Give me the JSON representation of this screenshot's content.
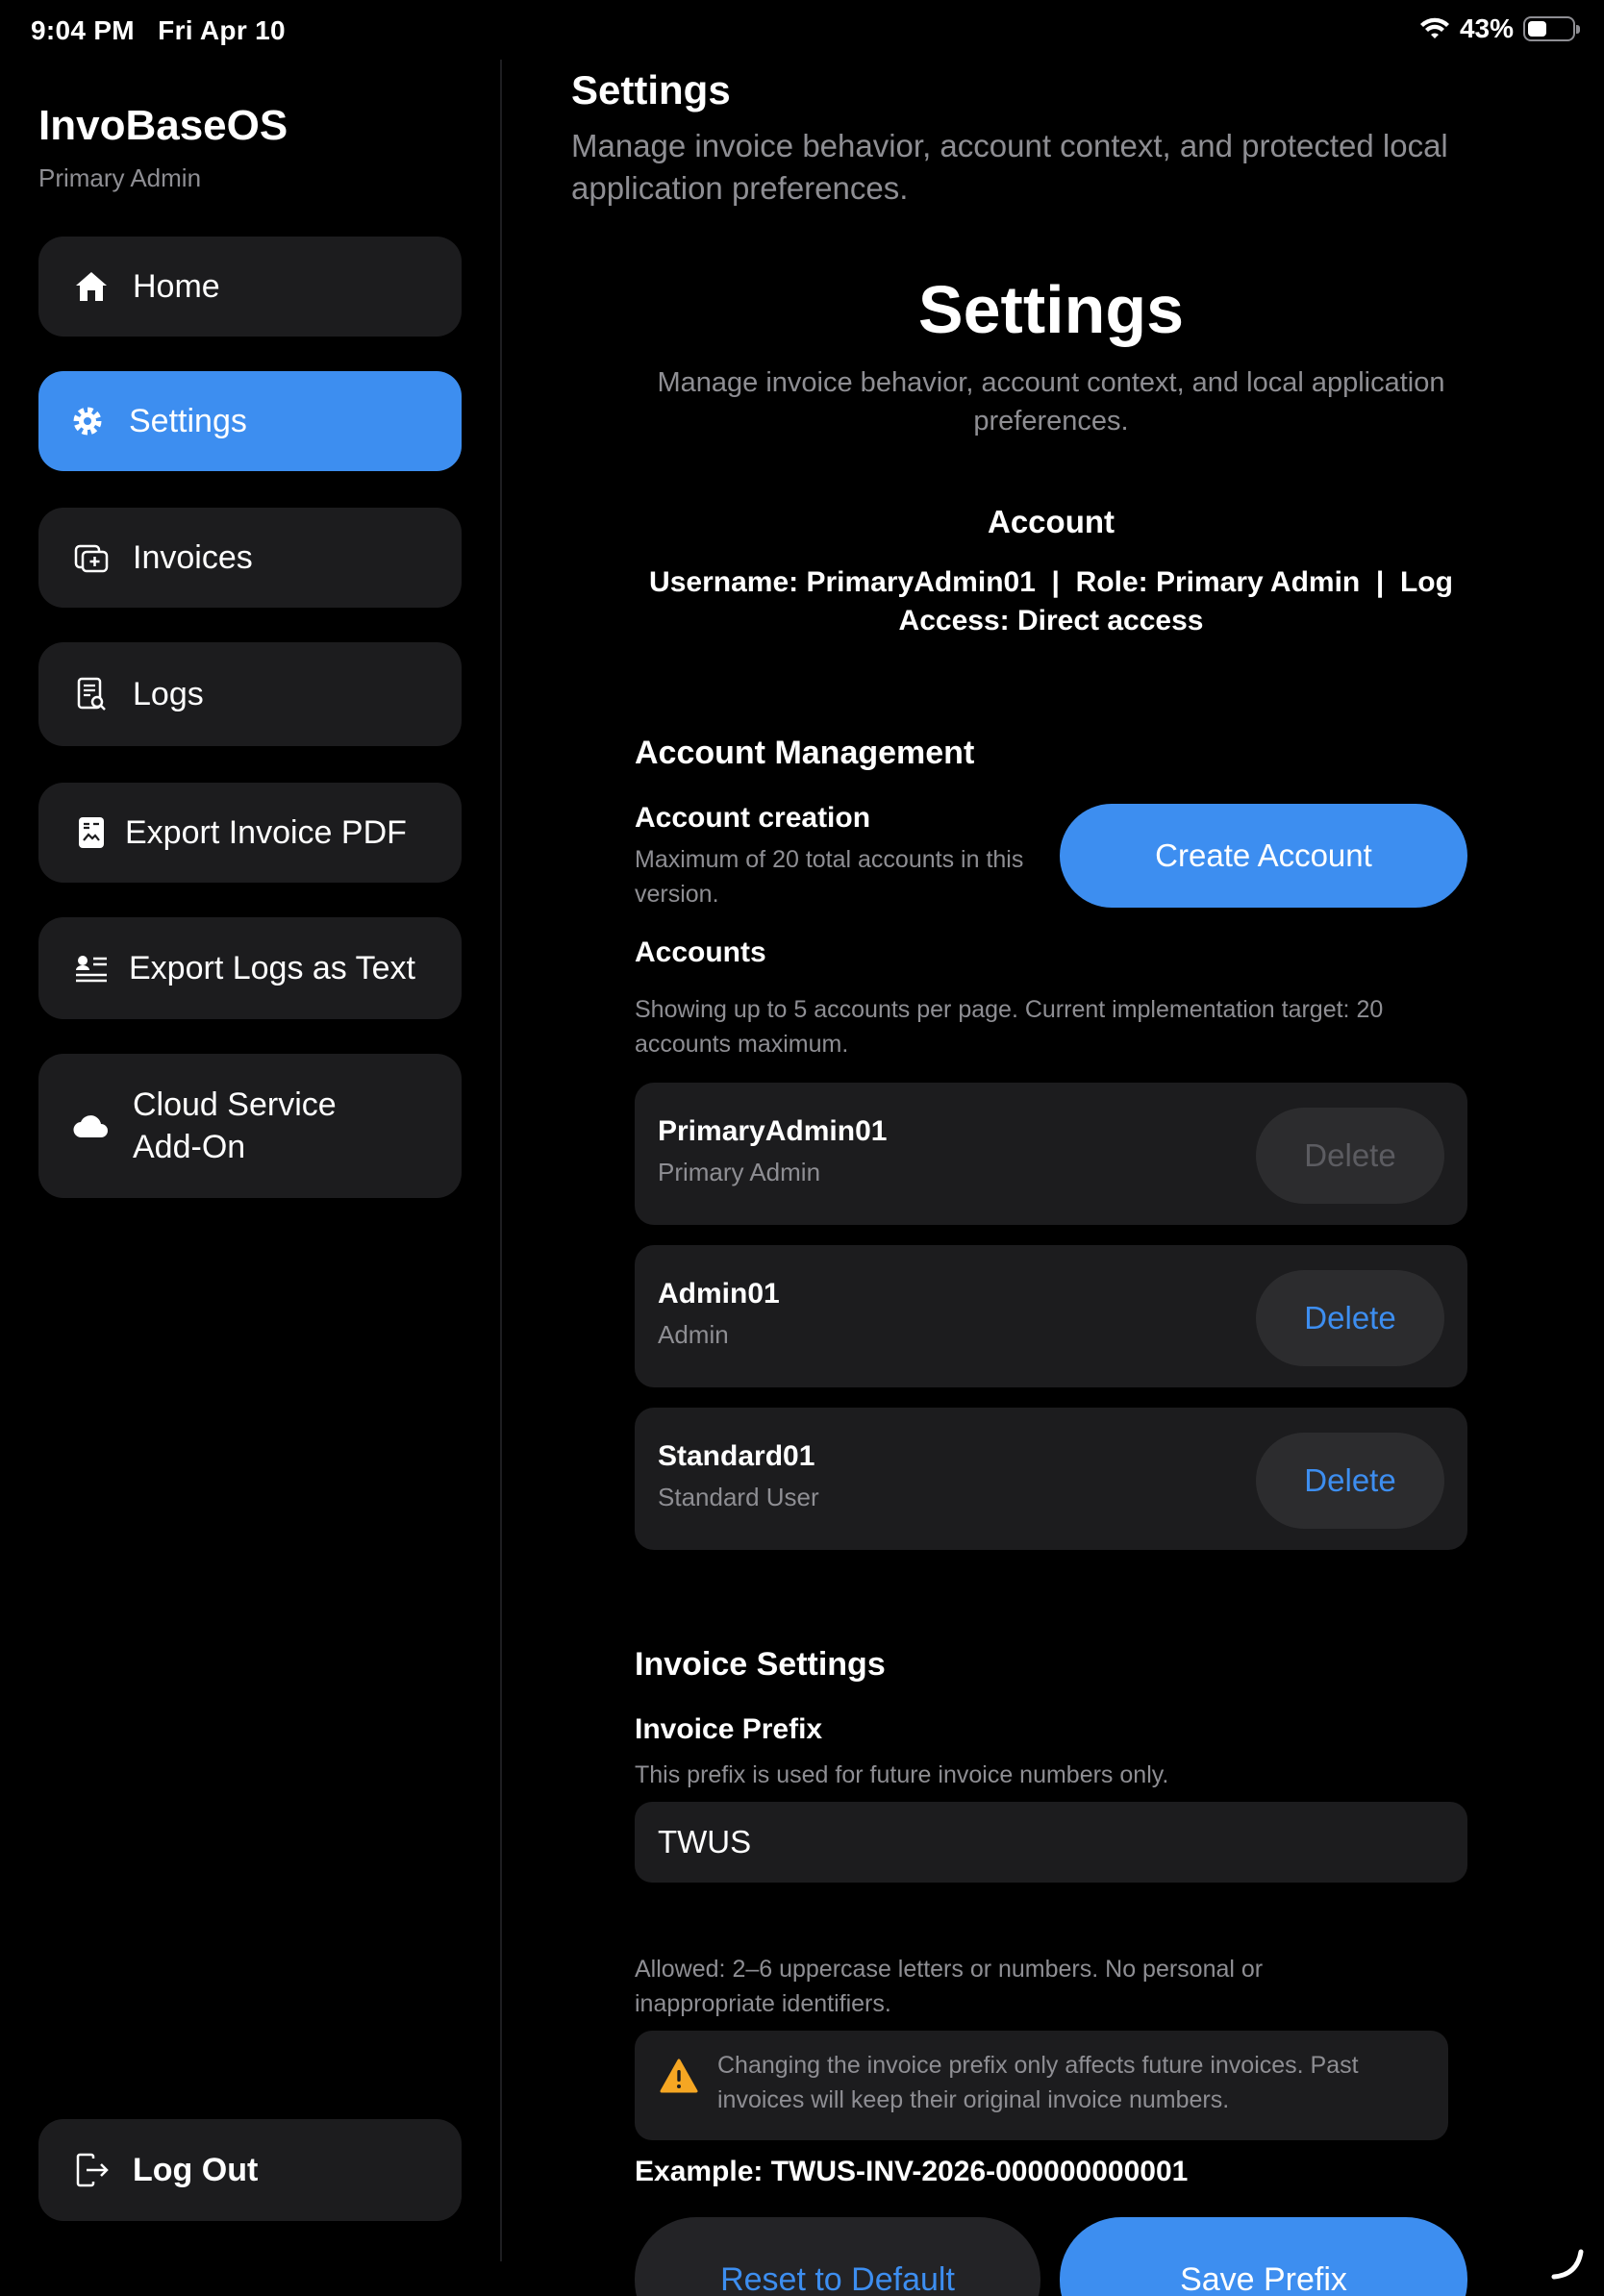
{
  "status_bar": {
    "time": "9:04 PM",
    "date": "Fri Apr 10",
    "battery": "43%",
    "battery_level": 0.43
  },
  "sidebar": {
    "app_name": "InvoBaseOS",
    "user_role": "Primary Admin",
    "items": [
      {
        "label": "Home",
        "icon": "house-icon",
        "active": false
      },
      {
        "label": "Settings",
        "icon": "gear-icon",
        "active": true
      },
      {
        "label": "Invoices",
        "icon": "add-document-icon",
        "active": false
      },
      {
        "label": "Logs",
        "icon": "log-search-icon",
        "active": false
      },
      {
        "label": "Export Invoice PDF",
        "icon": "pdf-export-icon",
        "active": false
      },
      {
        "label": "Export Logs as Text",
        "icon": "text-export-icon",
        "active": false
      },
      {
        "label_line1": "Cloud Service",
        "label_line2": "Add-On",
        "icon": "cloud-icon",
        "active": false
      }
    ],
    "logout_label": "Log Out"
  },
  "main": {
    "title": "Settings",
    "description": "Manage invoice behavior, account context, and protected local application preferences.",
    "big_title": "Settings",
    "big_description": "Manage invoice behavior, account context, and local application preferences.",
    "account": {
      "heading": "Account",
      "info_line1": "Username: PrimaryAdmin01  |  Role: Primary Admin  |  Log",
      "info_line2": "Access: Direct access"
    },
    "account_management": {
      "title": "Account Management",
      "creation_title": "Account creation",
      "creation_help": "Maximum of 20 total accounts in this version.",
      "create_button": "Create Account",
      "accounts_title": "Accounts",
      "accounts_help": "Showing up to 5 accounts per page. Current implementation target: 20 accounts maximum.",
      "accounts": [
        {
          "name": "PrimaryAdmin01",
          "role": "Primary Admin",
          "delete_label": "Delete",
          "delete_enabled": false
        },
        {
          "name": "Admin01",
          "role": "Admin",
          "delete_label": "Delete",
          "delete_enabled": true
        },
        {
          "name": "Standard01",
          "role": "Standard User",
          "delete_label": "Delete",
          "delete_enabled": true
        }
      ]
    },
    "invoice_settings": {
      "title": "Invoice Settings",
      "prefix_title": "Invoice Prefix",
      "prefix_help": "This prefix is used for future invoice numbers only.",
      "prefix_value": "TWUS",
      "allowed_help": "Allowed: 2–6 uppercase letters or numbers. No personal or inappropriate identifiers.",
      "warning": "Changing the invoice prefix only affects future invoices. Past invoices will keep their original invoice numbers.",
      "example": "Example: TWUS-INV-2026-000000000001",
      "reset_button": "Reset to Default",
      "save_button": "Save Prefix"
    }
  },
  "colors": {
    "accent": "#3d8ef0",
    "card": "#1c1c1e",
    "secondary_text": "#8e8e93",
    "warning": "#f5a623"
  }
}
